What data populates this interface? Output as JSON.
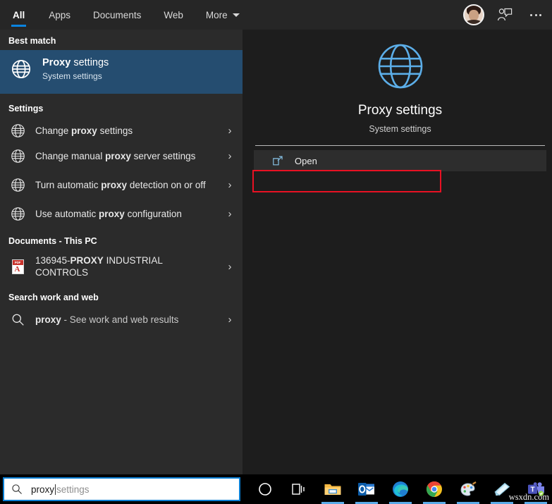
{
  "tabs": [
    {
      "label": "All",
      "active": true
    },
    {
      "label": "Apps",
      "active": false
    },
    {
      "label": "Documents",
      "active": false
    },
    {
      "label": "Web",
      "active": false
    },
    {
      "label": "More",
      "active": false,
      "caret": true
    }
  ],
  "header": {
    "avatar_name": "user-avatar",
    "feedback_label": "feedback-icon",
    "more_label": "more-options-icon"
  },
  "best_match": {
    "group_label": "Best match",
    "title_bold": "Proxy",
    "title_rest": " settings",
    "subtitle": "System settings",
    "icon": "globe-icon"
  },
  "settings_group": {
    "label": "Settings",
    "items": [
      {
        "pre": "Change ",
        "bold": "proxy",
        "post": " settings",
        "icon": "globe-icon",
        "chevron": "›"
      },
      {
        "pre": "Change manual ",
        "bold": "proxy",
        "post": " server settings",
        "icon": "globe-icon",
        "chevron": "›"
      },
      {
        "pre": "Turn automatic ",
        "bold": "proxy",
        "post": " detection on or off",
        "icon": "globe-icon",
        "chevron": "›"
      },
      {
        "pre": "Use automatic ",
        "bold": "proxy",
        "post": " configuration",
        "icon": "globe-icon",
        "chevron": "›"
      }
    ]
  },
  "documents_group": {
    "label": "Documents - This PC",
    "items": [
      {
        "pre": "136945-",
        "bold": "PROXY",
        "post": " INDUSTRIAL CONTROLS",
        "icon": "pdf-file-icon",
        "chevron": "›"
      }
    ]
  },
  "web_group": {
    "label": "Search work and web",
    "items": [
      {
        "pre": "",
        "bold": "proxy",
        "post": " - See work and web results",
        "icon": "search-icon",
        "chevron": "›"
      }
    ]
  },
  "preview": {
    "icon": "globe-icon-large",
    "title": "Proxy settings",
    "subtitle": "System settings",
    "actions": [
      {
        "label": "Open",
        "icon": "open-external-icon",
        "highlighted": true
      }
    ]
  },
  "taskbar": {
    "search": {
      "typed_value": "proxy",
      "suggestion_suffix": "settings",
      "icon": "search-icon"
    },
    "items": [
      {
        "name": "cortana-icon",
        "running": false
      },
      {
        "name": "task-view-icon",
        "running": false
      },
      {
        "name": "file-explorer-icon",
        "running": true
      },
      {
        "name": "outlook-icon",
        "running": true
      },
      {
        "name": "microsoft-edge-icon",
        "running": true
      },
      {
        "name": "google-chrome-icon",
        "running": true
      },
      {
        "name": "paint-icon",
        "running": true
      },
      {
        "name": "sticky-notes-icon",
        "running": true
      },
      {
        "name": "microsoft-teams-icon",
        "running": true
      }
    ]
  },
  "watermark": {
    "text": "wsxdn.com"
  },
  "colors": {
    "accent_blue": "#0a84e0",
    "best_match_highlight": "#254d70",
    "annotation_red": "#e81123",
    "panel_left_bg": "#2b2b2b",
    "panel_right_bg": "#1d1d1d",
    "globe_large": "#5caee8"
  }
}
